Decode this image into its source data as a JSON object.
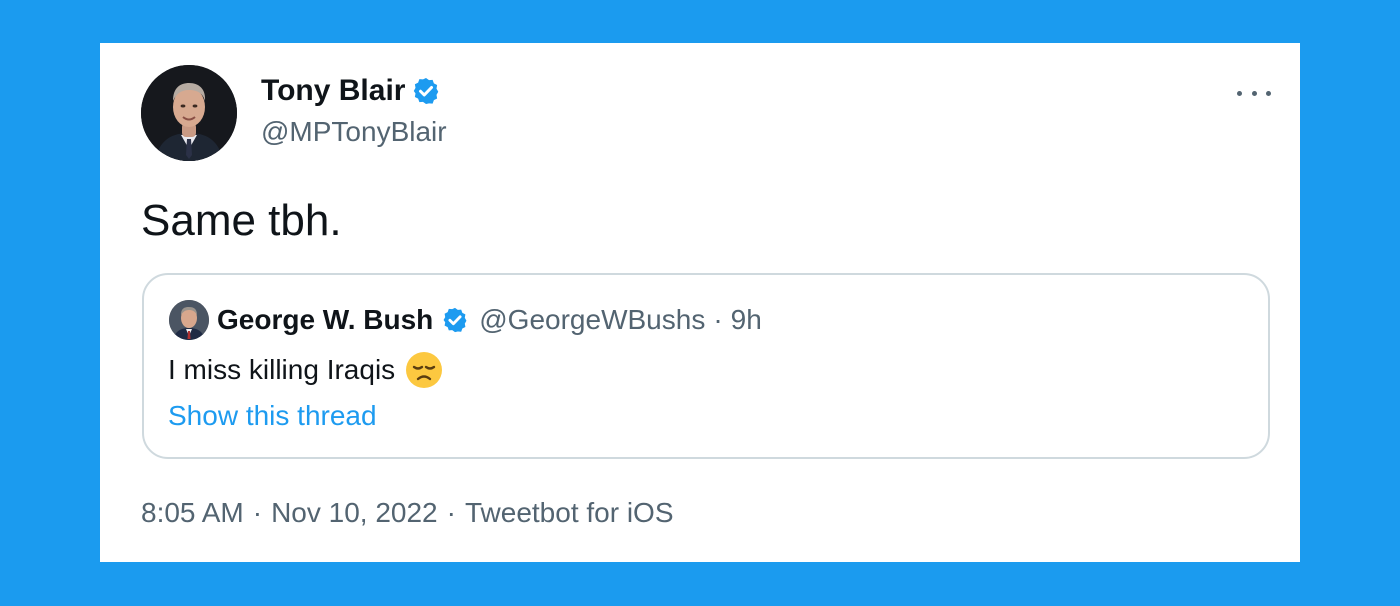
{
  "tweet": {
    "author": {
      "name": "Tony Blair",
      "handle": "@MPTonyBlair",
      "avatar_icon": "avatar-portrait-icon",
      "verified_icon": "verified-badge-icon"
    },
    "more_icon": "more-options-icon",
    "text": "Same tbh.",
    "quoted": {
      "author": {
        "name": "George W. Bush",
        "handle": "@GeorgeWBushs",
        "avatar_icon": "avatar-portrait-icon",
        "verified_icon": "verified-badge-icon"
      },
      "separator": "·",
      "time": "9h",
      "text": "I miss killing Iraqis",
      "emoji_icon": "disappointed-face-emoji",
      "show_thread_label": "Show this thread"
    },
    "meta": {
      "time": "8:05 AM",
      "separator": "·",
      "date": "Nov 10, 2022",
      "source": "Tweetbot for iOS"
    }
  },
  "colors": {
    "background": "#1b9bef",
    "card": "#ffffff",
    "text_primary": "#0f1419",
    "text_secondary": "#536471",
    "link": "#1d9bf0",
    "verified": "#1d9bf0",
    "border": "#cfd9de"
  }
}
